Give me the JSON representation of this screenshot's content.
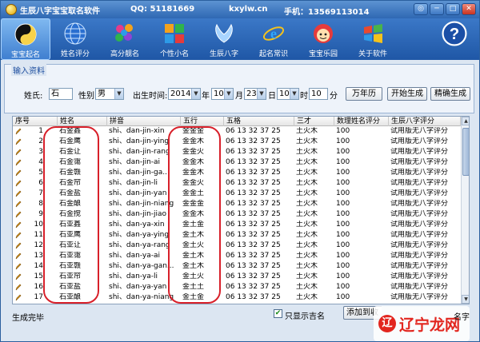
{
  "window": {
    "title": "生辰八字宝宝取名软件",
    "qq": "QQ: 51181669",
    "site": "kxylw.cn",
    "phone": "手机：13569113014",
    "controls": {
      "chat": "◎",
      "minimize": "─",
      "maximize": "□",
      "close": "✕"
    }
  },
  "toolbar": {
    "items": [
      {
        "label": "宝宝起名",
        "icon": "yin-yang-icon"
      },
      {
        "label": "姓名评分",
        "icon": "globe-icon"
      },
      {
        "label": "高分靓名",
        "icon": "colored-balls-icon"
      },
      {
        "label": "个性小名",
        "icon": "tiles-icon"
      },
      {
        "label": "生辰八字",
        "icon": "wings-icon"
      },
      {
        "label": "起名常识",
        "icon": "ie-icon"
      },
      {
        "label": "宝宝乐园",
        "icon": "mascot-icon"
      },
      {
        "label": "关于软件",
        "icon": "windows-flag-icon"
      },
      {
        "label": "",
        "icon": "help-icon"
      }
    ]
  },
  "input": {
    "legend": "输入资料",
    "surname_label": "姓氏:",
    "surname_value": "石",
    "gender_label": "性别:",
    "gender_value": "男",
    "birth_label": "出生时间:",
    "year": "2014",
    "year_unit": "年",
    "month": "10",
    "month_unit": "月",
    "day": "23",
    "day_unit": "日",
    "hour": "10",
    "hour_unit": "时",
    "minute": "10",
    "minute_unit": "分",
    "buttons": {
      "calendar": "万年历",
      "generate": "开始生成",
      "precise": "精确生成"
    }
  },
  "table": {
    "columns": [
      "序号",
      "姓名",
      "拼音",
      "五行",
      "五格",
      "三才",
      "数理姓名评分",
      "生辰八字评分"
    ],
    "rows": [
      [
        "1",
        "石金鑫",
        "shi、dan-jin-xin",
        "金金金",
        "06 13 32 37 25",
        "土火木",
        "100",
        "试用版无八字评分"
      ],
      [
        "2",
        "石金鹰",
        "shi、dan-jin-ying",
        "金金木",
        "06 13 32 37 25",
        "土火木",
        "100",
        "试用版无八字评分"
      ],
      [
        "3",
        "石金让",
        "shi、dan-jin-rang",
        "金金火",
        "06 13 32 37 25",
        "土火木",
        "100",
        "试用版无八字评分"
      ],
      [
        "4",
        "石金霭",
        "shi、dan-jin-ai",
        "金金木",
        "06 13 32 37 25",
        "土火木",
        "100",
        "试用版无八字评分"
      ],
      [
        "5",
        "石金赣",
        "shi、dan-jin-ga...",
        "金金木",
        "06 13 32 37 25",
        "土火木",
        "100",
        "试用版无八字评分"
      ],
      [
        "6",
        "石金帘",
        "shi、dan-jin-li",
        "金金火",
        "06 13 32 37 25",
        "土火木",
        "100",
        "试用版无八字评分"
      ],
      [
        "7",
        "石金盐",
        "shi、dan-jin-yan",
        "金金土",
        "06 13 32 37 25",
        "土火木",
        "100",
        "试用版无八字评分"
      ],
      [
        "8",
        "石金酿",
        "shi、dan-jin-niang",
        "金金金",
        "06 13 32 37 25",
        "土火木",
        "100",
        "试用版无八字评分"
      ],
      [
        "9",
        "石金搅",
        "shi、dan-jin-jiao",
        "金金木",
        "06 13 32 37 25",
        "土火木",
        "100",
        "试用版无八字评分"
      ],
      [
        "10",
        "石亚鑫",
        "shi、dan-ya-xin",
        "金土金",
        "06 13 32 37 25",
        "土火木",
        "100",
        "试用版无八字评分"
      ],
      [
        "11",
        "石亚鹰",
        "shi、dan-ya-ying",
        "金土木",
        "06 13 32 37 25",
        "土火木",
        "100",
        "试用版无八字评分"
      ],
      [
        "12",
        "石亚让",
        "shi、dan-ya-rang",
        "金土火",
        "06 13 32 37 25",
        "土火木",
        "100",
        "试用版无八字评分"
      ],
      [
        "13",
        "石亚霭",
        "shi、dan-ya-ai",
        "金土木",
        "06 13 32 37 25",
        "土火木",
        "100",
        "试用版无八字评分"
      ],
      [
        "14",
        "石亚赣",
        "shi、dan-ya-gan...",
        "金土木",
        "06 13 32 37 25",
        "土火木",
        "100",
        "试用版无八字评分"
      ],
      [
        "15",
        "石亚帘",
        "shi、dan-ya-li",
        "金土火",
        "06 13 32 37 25",
        "土火木",
        "100",
        "试用版无八字评分"
      ],
      [
        "16",
        "石亚盐",
        "shi、dan-ya-yan",
        "金土土",
        "06 13 32 37 25",
        "土火木",
        "100",
        "试用版无八字评分"
      ],
      [
        "17",
        "石亚酿",
        "shi、dan-ya-niang",
        "金土金",
        "06 13 32 37 25",
        "土火木",
        "100",
        "试用版无八字评分"
      ]
    ]
  },
  "footer": {
    "status": "生成完毕",
    "only_good_label": "只显示吉名",
    "only_good_checked": true,
    "add_button": "添加到收",
    "add_button_tail": "名字",
    "watermark": "辽宁龙网"
  },
  "colors": {
    "accent": "#1f57a6",
    "highlight_circle": "#d8202a"
  }
}
